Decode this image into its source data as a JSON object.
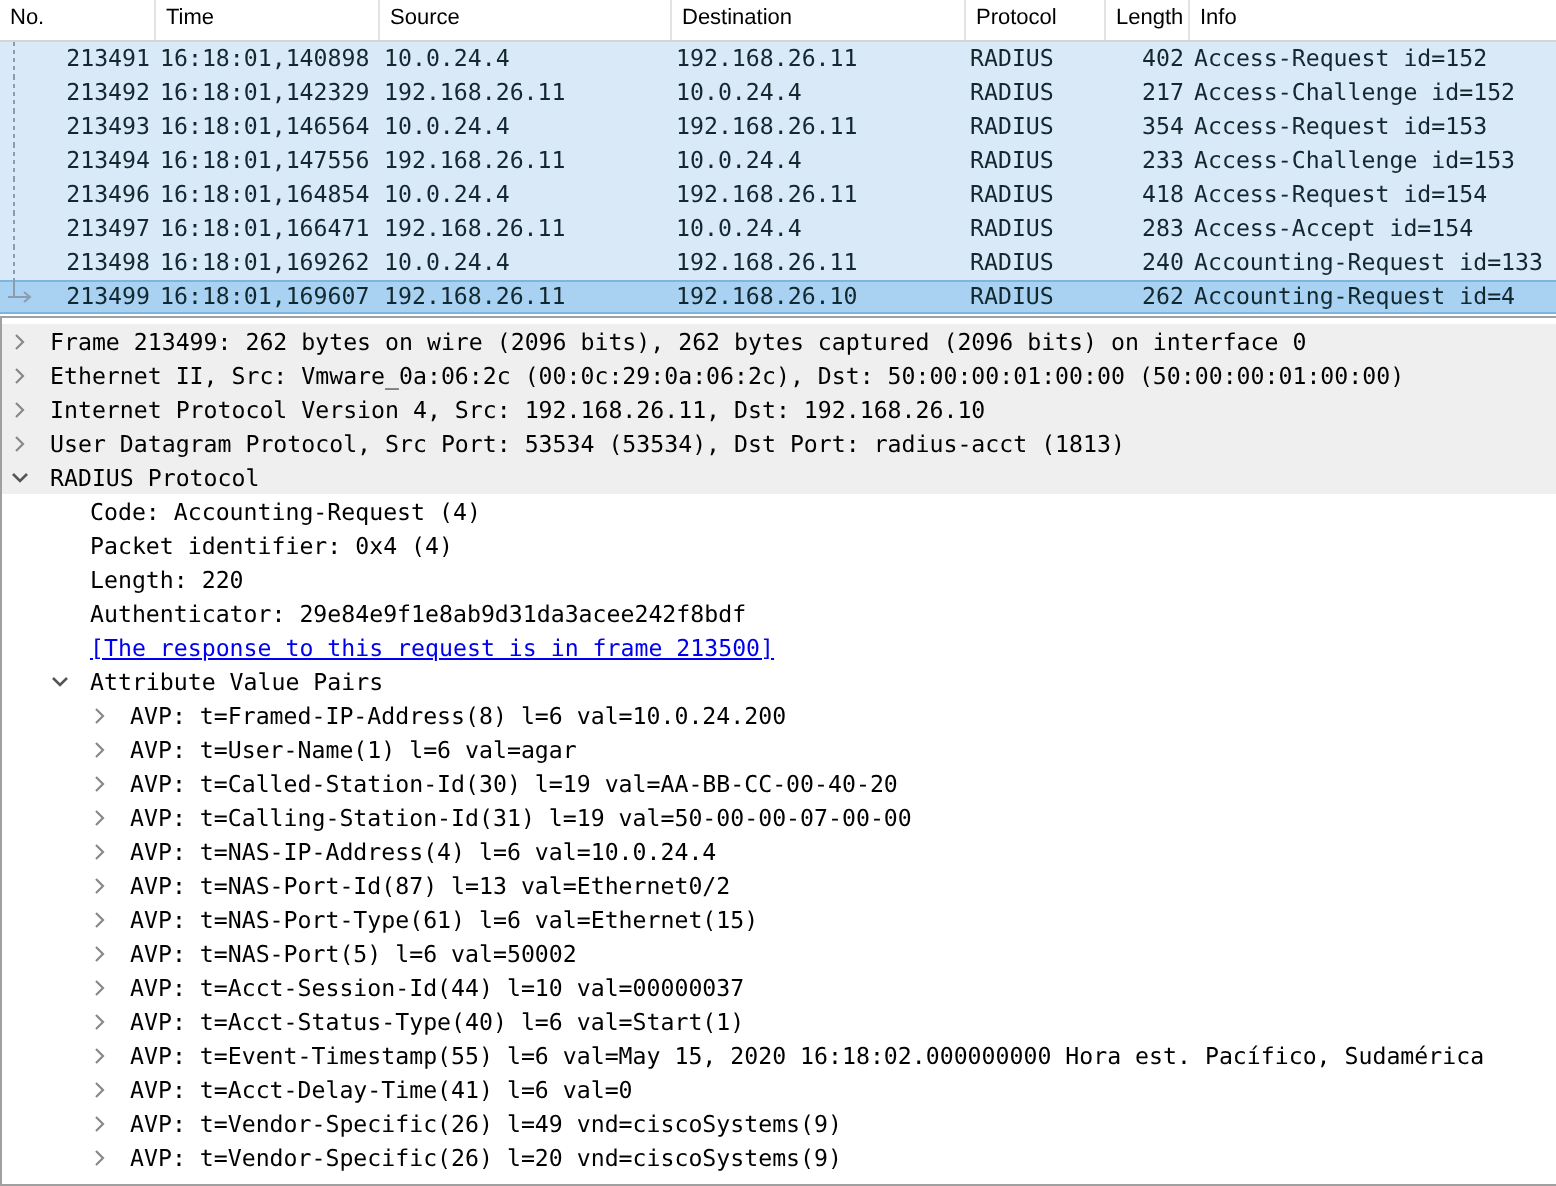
{
  "packet_list": {
    "columns": [
      "No.",
      "Time",
      "Source",
      "Destination",
      "Protocol",
      "Length",
      "Info"
    ],
    "rows": [
      {
        "cells": [
          "213491",
          "16:18:01,140898",
          "10.0.24.4",
          "192.168.26.11",
          "RADIUS",
          "402",
          "Access-Request id=152"
        ],
        "selected": false
      },
      {
        "cells": [
          "213492",
          "16:18:01,142329",
          "192.168.26.11",
          "10.0.24.4",
          "RADIUS",
          "217",
          "Access-Challenge id=152"
        ],
        "selected": false
      },
      {
        "cells": [
          "213493",
          "16:18:01,146564",
          "10.0.24.4",
          "192.168.26.11",
          "RADIUS",
          "354",
          "Access-Request id=153"
        ],
        "selected": false
      },
      {
        "cells": [
          "213494",
          "16:18:01,147556",
          "192.168.26.11",
          "10.0.24.4",
          "RADIUS",
          "233",
          "Access-Challenge id=153"
        ],
        "selected": false
      },
      {
        "cells": [
          "213496",
          "16:18:01,164854",
          "10.0.24.4",
          "192.168.26.11",
          "RADIUS",
          "418",
          "Access-Request id=154"
        ],
        "selected": false
      },
      {
        "cells": [
          "213497",
          "16:18:01,166471",
          "192.168.26.11",
          "10.0.24.4",
          "RADIUS",
          "283",
          "Access-Accept id=154"
        ],
        "selected": false
      },
      {
        "cells": [
          "213498",
          "16:18:01,169262",
          "10.0.24.4",
          "192.168.26.11",
          "RADIUS",
          "240",
          "Accounting-Request id=133"
        ],
        "selected": false
      },
      {
        "cells": [
          "213499",
          "16:18:01,169607",
          "192.168.26.11",
          "192.168.26.10",
          "RADIUS",
          "262",
          "Accounting-Request id=4"
        ],
        "selected": true
      }
    ]
  },
  "packet_details": [
    {
      "text": "Frame 213499: 262 bytes on wire (2096 bits), 262 bytes captured (2096 bits) on interface 0",
      "expanded": false
    },
    {
      "text": "Ethernet II, Src: Vmware_0a:06:2c (00:0c:29:0a:06:2c), Dst: 50:00:00:01:00:00 (50:00:00:01:00:00)",
      "expanded": false
    },
    {
      "text": "Internet Protocol Version 4, Src: 192.168.26.11, Dst: 192.168.26.10",
      "expanded": false
    },
    {
      "text": "User Datagram Protocol, Src Port: 53534 (53534), Dst Port: radius-acct (1813)",
      "expanded": false
    },
    {
      "text": "RADIUS Protocol",
      "expanded": true,
      "children": [
        {
          "kind": "field",
          "text": "Code: Accounting-Request (4)"
        },
        {
          "kind": "field",
          "text": "Packet identifier: 0x4 (4)"
        },
        {
          "kind": "field",
          "text": "Length: 220"
        },
        {
          "kind": "field",
          "text": "Authenticator: 29e84e9f1e8ab9d31da3acee242f8bdf"
        },
        {
          "kind": "link",
          "text": "[The response to this request is in frame 213500]"
        },
        {
          "kind": "tree",
          "text": "Attribute Value Pairs",
          "expanded": true,
          "children": [
            {
              "kind": "tree",
              "text": "AVP: t=Framed-IP-Address(8) l=6 val=10.0.24.200",
              "expanded": false
            },
            {
              "kind": "tree",
              "text": "AVP: t=User-Name(1) l=6 val=agar",
              "expanded": false
            },
            {
              "kind": "tree",
              "text": "AVP: t=Called-Station-Id(30) l=19 val=AA-BB-CC-00-40-20",
              "expanded": false
            },
            {
              "kind": "tree",
              "text": "AVP: t=Calling-Station-Id(31) l=19 val=50-00-00-07-00-00",
              "expanded": false
            },
            {
              "kind": "tree",
              "text": "AVP: t=NAS-IP-Address(4) l=6 val=10.0.24.4",
              "expanded": false
            },
            {
              "kind": "tree",
              "text": "AVP: t=NAS-Port-Id(87) l=13 val=Ethernet0/2",
              "expanded": false
            },
            {
              "kind": "tree",
              "text": "AVP: t=NAS-Port-Type(61) l=6 val=Ethernet(15)",
              "expanded": false
            },
            {
              "kind": "tree",
              "text": "AVP: t=NAS-Port(5) l=6 val=50002",
              "expanded": false
            },
            {
              "kind": "tree",
              "text": "AVP: t=Acct-Session-Id(44) l=10 val=00000037",
              "expanded": false
            },
            {
              "kind": "tree",
              "text": "AVP: t=Acct-Status-Type(40) l=6 val=Start(1)",
              "expanded": false
            },
            {
              "kind": "tree",
              "text": "AVP: t=Event-Timestamp(55) l=6 val=May 15, 2020 16:18:02.000000000 Hora est. Pacífico, Sudamérica",
              "expanded": false
            },
            {
              "kind": "tree",
              "text": "AVP: t=Acct-Delay-Time(41) l=6 val=0",
              "expanded": false
            },
            {
              "kind": "tree",
              "text": "AVP: t=Vendor-Specific(26) l=49 vnd=ciscoSystems(9)",
              "expanded": false
            },
            {
              "kind": "tree",
              "text": "AVP: t=Vendor-Specific(26) l=20 vnd=ciscoSystems(9)",
              "expanded": false
            }
          ]
        }
      ]
    }
  ]
}
